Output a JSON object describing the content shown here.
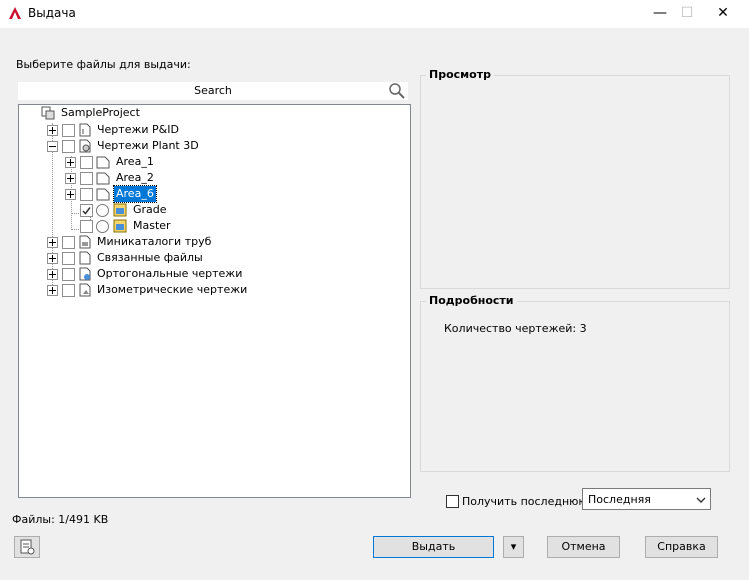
{
  "window": {
    "title": "Выдача",
    "minimize": "—",
    "maximize": "☐",
    "close": "✕"
  },
  "left": {
    "prompt": "Выберите файлы для выдачи:",
    "search_placeholder": "Search",
    "footer": "Файлы: 1/491 KB"
  },
  "tree": {
    "root": "SampleProject",
    "items": [
      {
        "label": "Чертежи P&ID"
      },
      {
        "label": "Чертежи Plant 3D"
      },
      {
        "label": "Area_1"
      },
      {
        "label": "Area_2"
      },
      {
        "label": "Area_6"
      },
      {
        "label": "Grade"
      },
      {
        "label": "Master"
      },
      {
        "label": "Миникаталоги труб"
      },
      {
        "label": "Связанные файлы"
      },
      {
        "label": "Ортогональные чертежи"
      },
      {
        "label": "Изометрические чертежи"
      }
    ]
  },
  "preview": {
    "title": "Просмотр"
  },
  "details": {
    "title": "Подробности",
    "text": "Количество чертежей: 3"
  },
  "options": {
    "latest_checkbox": "Получить последнюю",
    "version_select": "Последняя"
  },
  "buttons": {
    "issue": "Выдать",
    "dropdown": "▾",
    "cancel": "Отмена",
    "help": "Справка"
  },
  "colors": {
    "accent": "#0078d7",
    "autocad_red": "#c8102e"
  }
}
